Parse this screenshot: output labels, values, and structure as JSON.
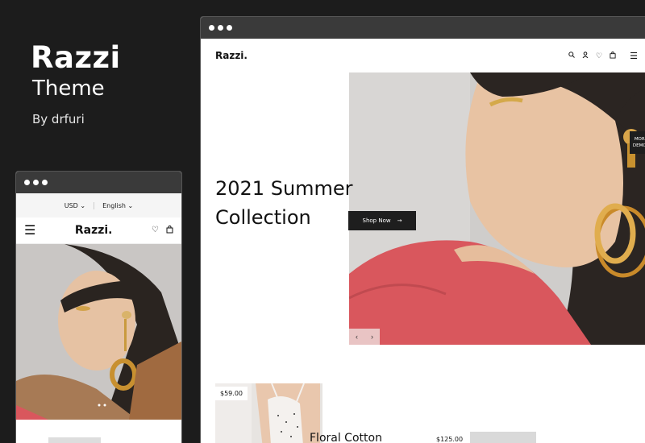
{
  "promo": {
    "title": "Razzi",
    "subtitle": "Theme",
    "author": "By drfuri"
  },
  "mobile": {
    "currency": "USD",
    "language": "English",
    "logo": "Razzi.",
    "icons": [
      "menu-icon",
      "heart-icon",
      "bag-icon"
    ]
  },
  "desktop": {
    "logo": "Razzi.",
    "icons": [
      "search-icon",
      "user-icon",
      "heart-icon",
      "bag-icon",
      "menu-icon"
    ],
    "hero": {
      "heading_line1": "2021 Summer",
      "heading_line2": "Collection",
      "button_label": "Shop Now",
      "more_demos_line1": "MORE",
      "more_demos_line2": "DEMOS"
    },
    "products": [
      {
        "price": "$59.00",
        "name": "Floral Cotton"
      },
      {
        "price": "$125.00"
      }
    ]
  },
  "colors": {
    "background": "#1c1c1c",
    "titlebar": "#3a3a3a",
    "button": "#1e1e1e",
    "skin": "#e8c7a8",
    "sweater": "#d9575d"
  }
}
